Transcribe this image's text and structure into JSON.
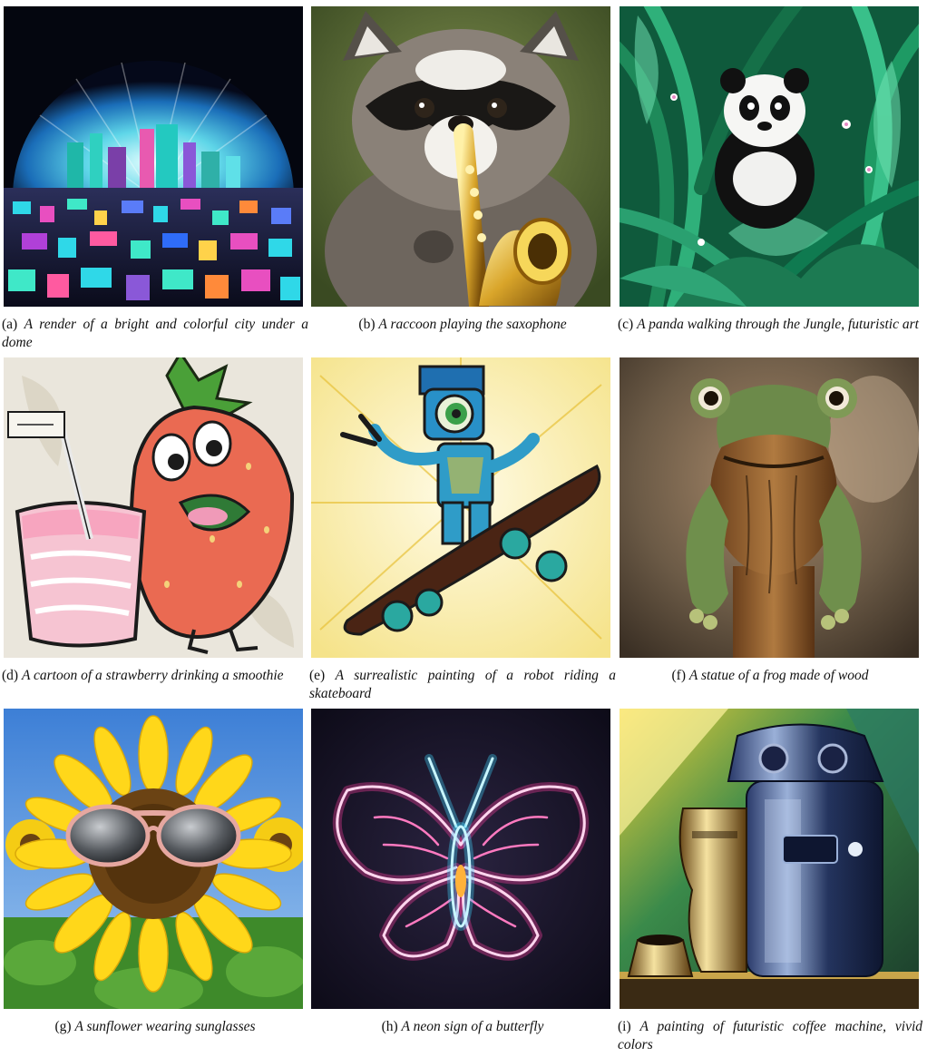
{
  "panels": [
    {
      "label": "(a)",
      "caption": "A render of a bright and colorful city under a dome"
    },
    {
      "label": "(b)",
      "caption": "A raccoon playing the saxophone"
    },
    {
      "label": "(c)",
      "caption": "A panda walking through the Jungle, futuristic art"
    },
    {
      "label": "(d)",
      "caption": "A cartoon of a strawberry drinking a smoothie"
    },
    {
      "label": "(e)",
      "caption": "A surrealistic painting of a robot riding a skateboard"
    },
    {
      "label": "(f)",
      "caption": "A statue of a frog made of wood"
    },
    {
      "label": "(g)",
      "caption": "A sunflower wearing sunglasses"
    },
    {
      "label": "(h)",
      "caption": "A neon sign of a butterfly"
    },
    {
      "label": "(i)",
      "caption": "A painting of futuristic coffee machine, vivid colors"
    }
  ]
}
